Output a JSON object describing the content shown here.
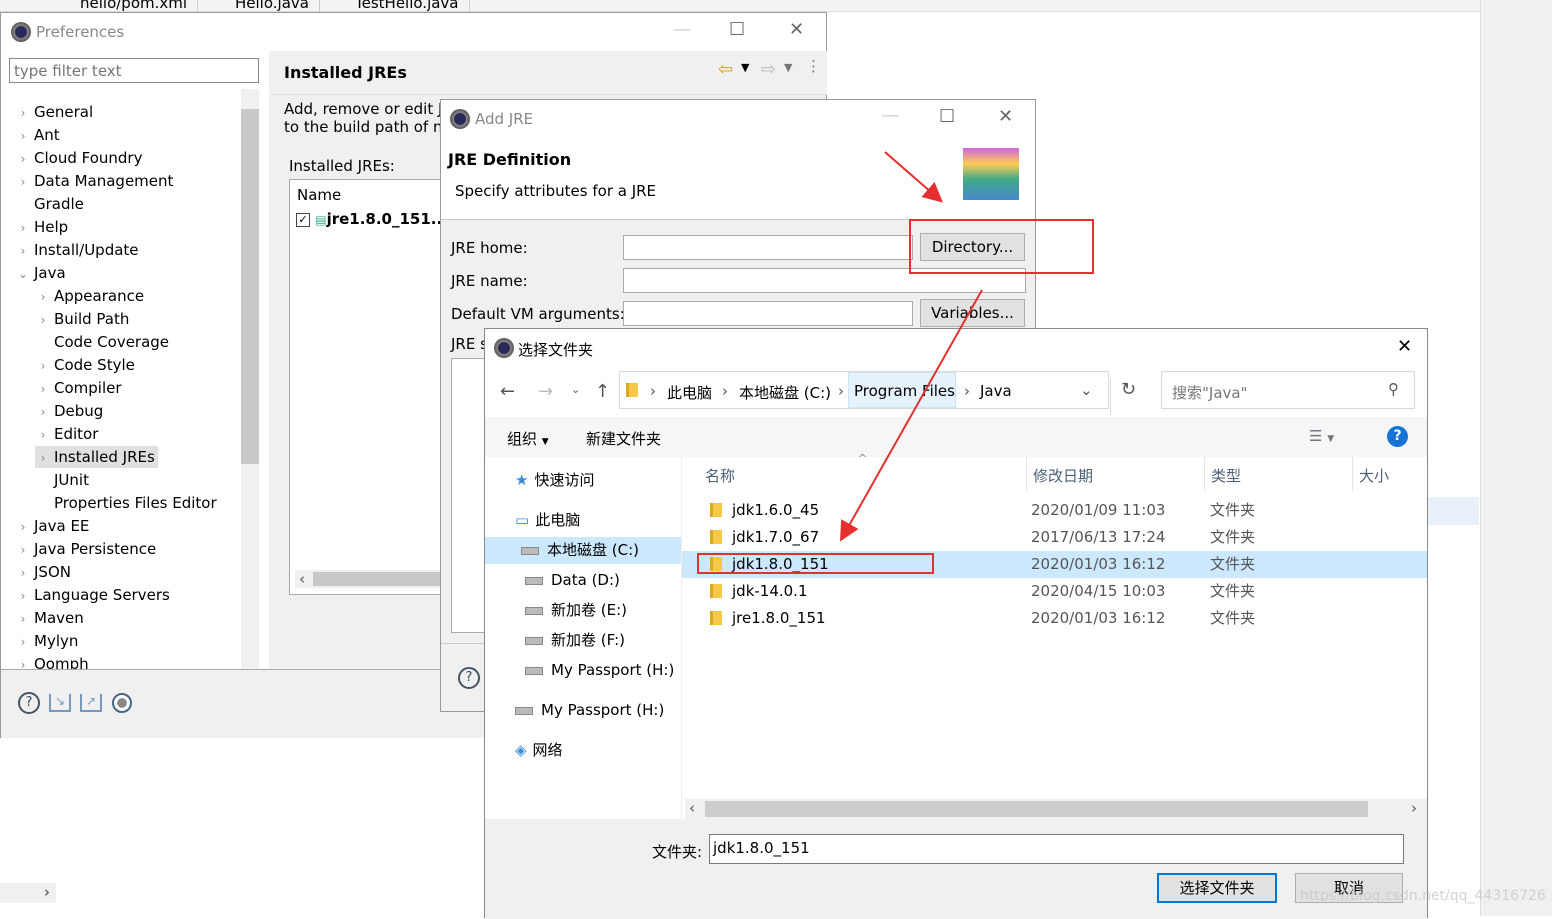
{
  "editor": {
    "tabs": [
      "hello/pom.xml",
      "Hello.java",
      "TestHello.java"
    ]
  },
  "preferences": {
    "title": "Preferences",
    "filter_placeholder": "type filter text",
    "tree": [
      {
        "label": "General",
        "level": 0,
        "chevron": "right"
      },
      {
        "label": "Ant",
        "level": 0,
        "chevron": "right"
      },
      {
        "label": "Cloud Foundry",
        "level": 0,
        "chevron": "right"
      },
      {
        "label": "Data Management",
        "level": 0,
        "chevron": "right"
      },
      {
        "label": "Gradle",
        "level": 0,
        "chevron": "none"
      },
      {
        "label": "Help",
        "level": 0,
        "chevron": "right"
      },
      {
        "label": "Install/Update",
        "level": 0,
        "chevron": "right"
      },
      {
        "label": "Java",
        "level": 0,
        "chevron": "down"
      },
      {
        "label": "Appearance",
        "level": 1,
        "chevron": "right"
      },
      {
        "label": "Build Path",
        "level": 1,
        "chevron": "right"
      },
      {
        "label": "Code Coverage",
        "level": 1,
        "chevron": "none"
      },
      {
        "label": "Code Style",
        "level": 1,
        "chevron": "right"
      },
      {
        "label": "Compiler",
        "level": 1,
        "chevron": "right"
      },
      {
        "label": "Debug",
        "level": 1,
        "chevron": "right"
      },
      {
        "label": "Editor",
        "level": 1,
        "chevron": "right"
      },
      {
        "label": "Installed JREs",
        "level": 1,
        "chevron": "right",
        "selected": true
      },
      {
        "label": "JUnit",
        "level": 1,
        "chevron": "none"
      },
      {
        "label": "Properties Files Editor",
        "level": 1,
        "chevron": "none"
      },
      {
        "label": "Java EE",
        "level": 0,
        "chevron": "right"
      },
      {
        "label": "Java Persistence",
        "level": 0,
        "chevron": "right"
      },
      {
        "label": "JSON",
        "level": 0,
        "chevron": "right"
      },
      {
        "label": "Language Servers",
        "level": 0,
        "chevron": "right"
      },
      {
        "label": "Maven",
        "level": 0,
        "chevron": "right"
      },
      {
        "label": "Mylyn",
        "level": 0,
        "chevron": "right"
      },
      {
        "label": "Oomph",
        "level": 0,
        "chevron": "right"
      }
    ],
    "page_title": "Installed JREs",
    "description_line1": "Add, remove or edit J",
    "description_line2": "to the build path of ne",
    "installed_label": "Installed JREs:",
    "table_header": "Name",
    "jre_row": "jre1.8.0_151...",
    "jre_checked": true
  },
  "add_jre": {
    "title": "Add JRE",
    "heading": "JRE Definition",
    "subheading": "Specify attributes for a JRE",
    "jre_home_label": "JRE home:",
    "jre_home_value": "",
    "jre_name_label": "JRE name:",
    "jre_name_value": "",
    "vm_args_label": "Default VM arguments:",
    "vm_args_value": "",
    "directory_button": "Directory...",
    "variables_button": "Variables...",
    "jre_system_label": "JRE s"
  },
  "folder_dialog": {
    "title": "选择文件夹",
    "breadcrumb": [
      "此电脑",
      "本地磁盘 (C:)",
      "Program Files",
      "Java"
    ],
    "search_placeholder": "搜索\"Java\"",
    "organize": "组织",
    "new_folder": "新建文件夹",
    "columns": [
      "名称",
      "修改日期",
      "类型",
      "大小"
    ],
    "nav": [
      {
        "label": "快速访问",
        "icon": "star-icon"
      },
      {
        "label": "此电脑",
        "icon": "computer-icon"
      },
      {
        "label": "本地磁盘 (C:)",
        "icon": "windows-drive-icon",
        "selected": true
      },
      {
        "label": "Data (D:)",
        "icon": "drive-icon"
      },
      {
        "label": "新加卷 (E:)",
        "icon": "drive-icon"
      },
      {
        "label": "新加卷 (F:)",
        "icon": "drive-icon"
      },
      {
        "label": "My Passport (H:)",
        "icon": "drive-icon"
      },
      {
        "label": "My Passport (H:)",
        "icon": "drive-icon"
      },
      {
        "label": "网络",
        "icon": "network-icon"
      }
    ],
    "files": [
      {
        "name": "jdk1.6.0_45",
        "date": "2020/01/09 11:03",
        "type": "文件夹"
      },
      {
        "name": "jdk1.7.0_67",
        "date": "2017/06/13 17:24",
        "type": "文件夹"
      },
      {
        "name": "jdk1.8.0_151",
        "date": "2020/01/03 16:12",
        "type": "文件夹",
        "selected": true
      },
      {
        "name": "jdk-14.0.1",
        "date": "2020/04/15 10:03",
        "type": "文件夹"
      },
      {
        "name": "jre1.8.0_151",
        "date": "2020/01/03 16:12",
        "type": "文件夹"
      }
    ],
    "folder_label": "文件夹:",
    "folder_value": "jdk1.8.0_151",
    "select_button": "选择文件夹",
    "cancel_button": "取消"
  },
  "watermark": "https://blog.csdn.net/qq_44316726",
  "colors": {
    "annotation": "#e53030",
    "selection": "#cce8ff",
    "accent": "#0078d7"
  }
}
